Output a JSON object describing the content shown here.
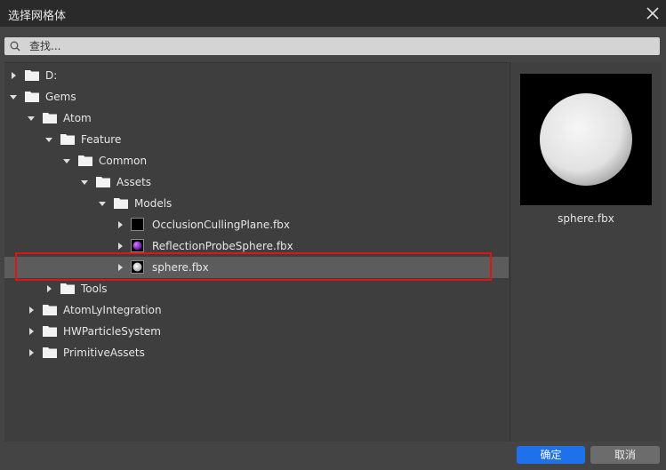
{
  "window": {
    "title": "选择网格体"
  },
  "search": {
    "placeholder": "查找..."
  },
  "tree": {
    "rows": [
      {
        "label": "D:",
        "type": "folder",
        "expanded": false
      },
      {
        "label": "Gems",
        "type": "folder",
        "expanded": true
      },
      {
        "label": "Atom",
        "type": "folder",
        "expanded": true
      },
      {
        "label": "Feature",
        "type": "folder",
        "expanded": true
      },
      {
        "label": "Common",
        "type": "folder",
        "expanded": true
      },
      {
        "label": "Assets",
        "type": "folder",
        "expanded": true
      },
      {
        "label": "Models",
        "type": "folder",
        "expanded": true
      },
      {
        "label": "OcclusionCullingPlane.fbx",
        "type": "file",
        "thumb": "black"
      },
      {
        "label": "ReflectionProbeSphere.fbx",
        "type": "file",
        "thumb": "purple-sphere"
      },
      {
        "label": "sphere.fbx",
        "type": "file",
        "thumb": "white-sphere",
        "selected": true
      },
      {
        "label": "Tools",
        "type": "folder",
        "expanded": false
      },
      {
        "label": "AtomLyIntegration",
        "type": "folder",
        "expanded": false
      },
      {
        "label": "HWParticleSystem",
        "type": "folder",
        "expanded": false
      },
      {
        "label": "PrimitiveAssets",
        "type": "folder",
        "expanded": false
      }
    ]
  },
  "preview": {
    "filename": "sphere.fbx"
  },
  "buttons": {
    "ok_label": "确定",
    "cancel_label": "取消"
  },
  "colors": {
    "accent": "#1e70eb",
    "highlight_outline": "#e01414",
    "selected_row": "#5c5c5c"
  }
}
